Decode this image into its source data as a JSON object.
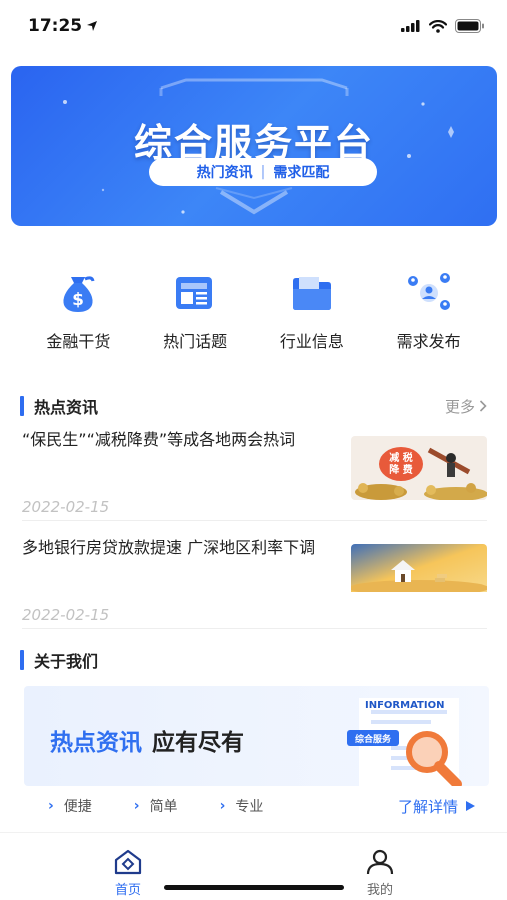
{
  "status": {
    "time": "17:25"
  },
  "banner": {
    "title": "综合服务平台",
    "sub_left": "热门资讯",
    "sub_sep": "|",
    "sub_right": "需求匹配"
  },
  "quick_menu": [
    {
      "label": "金融干货",
      "icon": "money-bag-icon"
    },
    {
      "label": "热门话题",
      "icon": "newspaper-icon"
    },
    {
      "label": "行业信息",
      "icon": "folder-icon"
    },
    {
      "label": "需求发布",
      "icon": "people-network-icon"
    }
  ],
  "hot_news": {
    "title": "热点资讯",
    "more": "更多",
    "items": [
      {
        "title": "“保民生”“减税降费”等成各地两会热词",
        "date": "2022-02-15"
      },
      {
        "title": "多地银行房贷放款提速 广深地区利率下调",
        "date": "2022-02-15"
      }
    ]
  },
  "about": {
    "title": "关于我们",
    "headline_blue": "热点资讯",
    "headline_dark": "应有尽有",
    "tag_info": "INFORMATION",
    "tag_service": "综合服务",
    "features": [
      "便捷",
      "简单",
      "专业"
    ],
    "more": "了解详情"
  },
  "tabs": [
    {
      "label": "首页",
      "active": true
    },
    {
      "label": "我的",
      "active": false
    }
  ],
  "colors": {
    "accent": "#2e6df0",
    "banner": "#3378f3"
  }
}
